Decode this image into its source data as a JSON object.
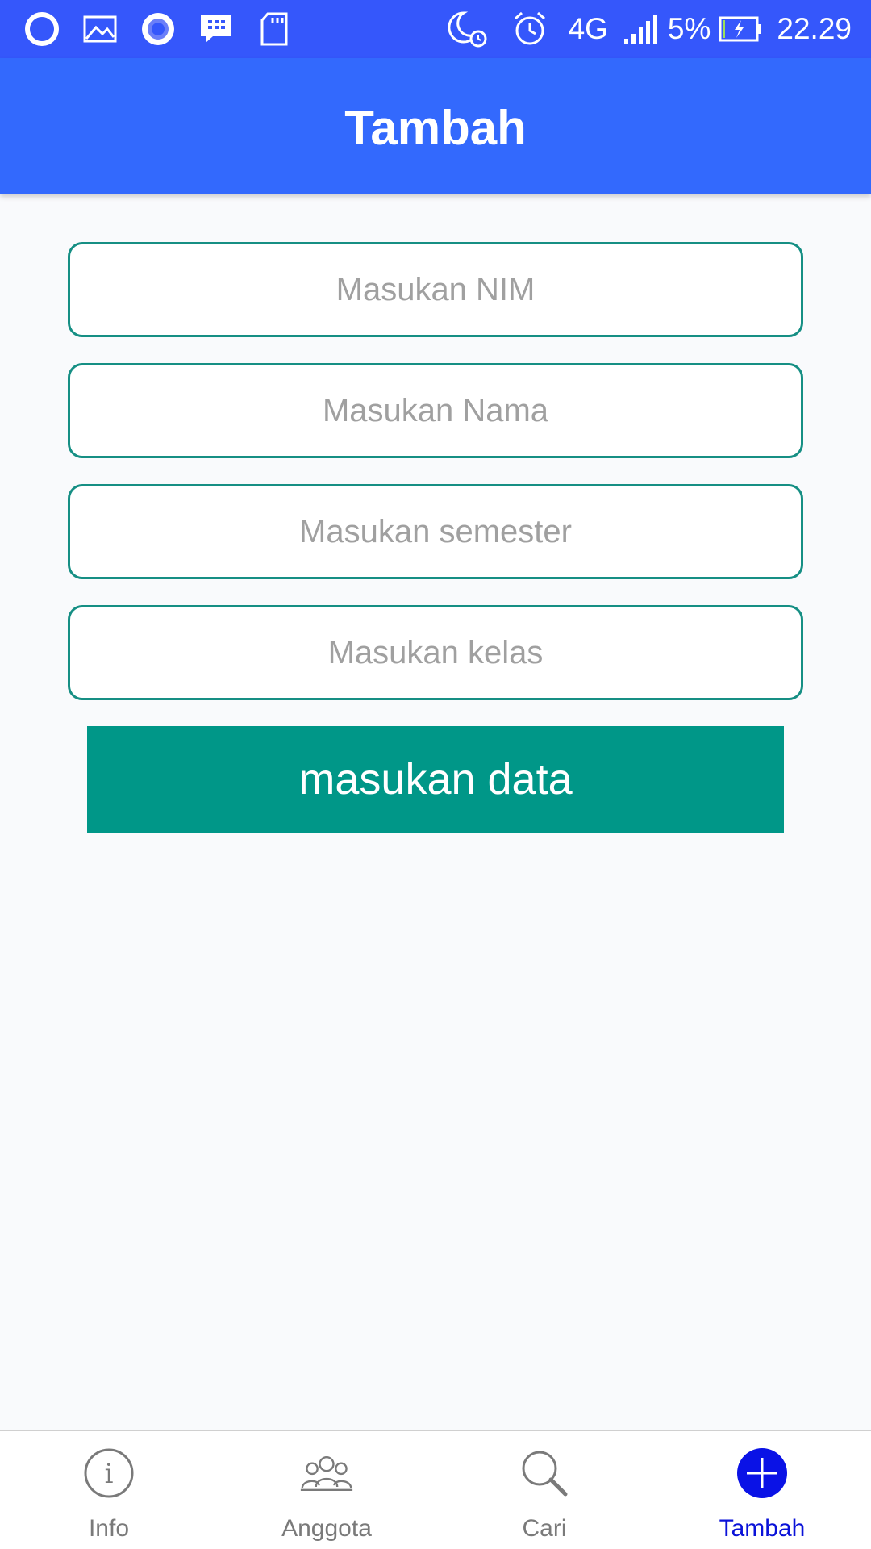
{
  "status_bar": {
    "left_icons": [
      "opera-icon",
      "gallery-icon",
      "record-icon",
      "bbm-icon",
      "sd-card-icon"
    ],
    "right_icons": [
      "night-alarm-icon",
      "alarm-icon"
    ],
    "network": "4G",
    "battery_percent": "5%",
    "time": "22.29"
  },
  "app_bar": {
    "title": "Tambah"
  },
  "form": {
    "nim_placeholder": "Masukan NIM",
    "nama_placeholder": "Masukan Nama",
    "semester_placeholder": "Masukan semester",
    "kelas_placeholder": "Masukan kelas",
    "submit_label": "masukan data"
  },
  "bottom_nav": {
    "items": [
      {
        "label": "Info",
        "icon": "info-icon"
      },
      {
        "label": "Anggota",
        "icon": "group-icon"
      },
      {
        "label": "Cari",
        "icon": "search-icon"
      },
      {
        "label": "Tambah",
        "icon": "add-icon"
      }
    ],
    "active_index": 3
  },
  "colors": {
    "status_bar": "#3557fb",
    "app_bar": "#3369fd",
    "field_border": "#168f84",
    "button": "#009788",
    "nav_active": "#0a12d8",
    "nav_inactive": "#7a7a7a"
  }
}
